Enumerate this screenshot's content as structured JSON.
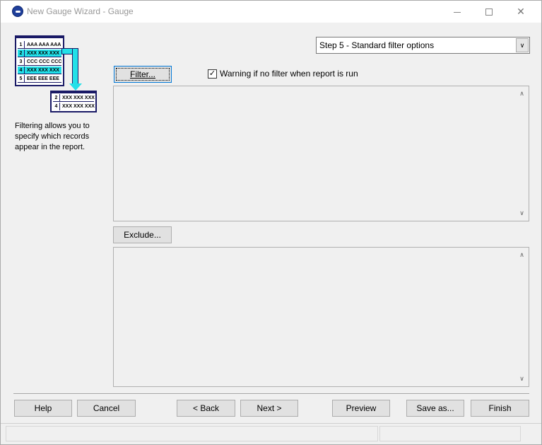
{
  "window": {
    "title": "New Gauge Wizard - Gauge",
    "minimize_glyph": "",
    "maximize_glyph": "",
    "close_glyph": "✕"
  },
  "illustration": {
    "rows": [
      {
        "num": "1",
        "text": "AAA AAA AAA"
      },
      {
        "num": "2",
        "text": "XXX XXX XXX"
      },
      {
        "num": "3",
        "text": "CCC CCC CCC"
      },
      {
        "num": "4",
        "text": "XXX XXX XXX"
      },
      {
        "num": "5",
        "text": "EEE EEE EEE"
      }
    ],
    "result_rows": [
      {
        "num": "2",
        "text": "XXX XXX XXX"
      },
      {
        "num": "4",
        "text": "XXX XXX XXX"
      }
    ],
    "highlight_color": "#22e0e8"
  },
  "description": "Filtering allows you to specify which records appear in the report.",
  "step_select": {
    "value": "Step 5 - Standard filter options",
    "arrow": "∨"
  },
  "filter_button": {
    "label": "Filter..."
  },
  "warning_checkbox": {
    "label": "Warning if no filter when report is run",
    "checked": true,
    "mark": "✓"
  },
  "exclude_button": {
    "label": "Exclude..."
  },
  "scroll": {
    "up": "∧",
    "down": "∨"
  },
  "footer": {
    "help": "Help",
    "cancel": "Cancel",
    "back": "< Back",
    "next": "Next >",
    "preview": "Preview",
    "save_as": "Save as...",
    "finish": "Finish"
  }
}
